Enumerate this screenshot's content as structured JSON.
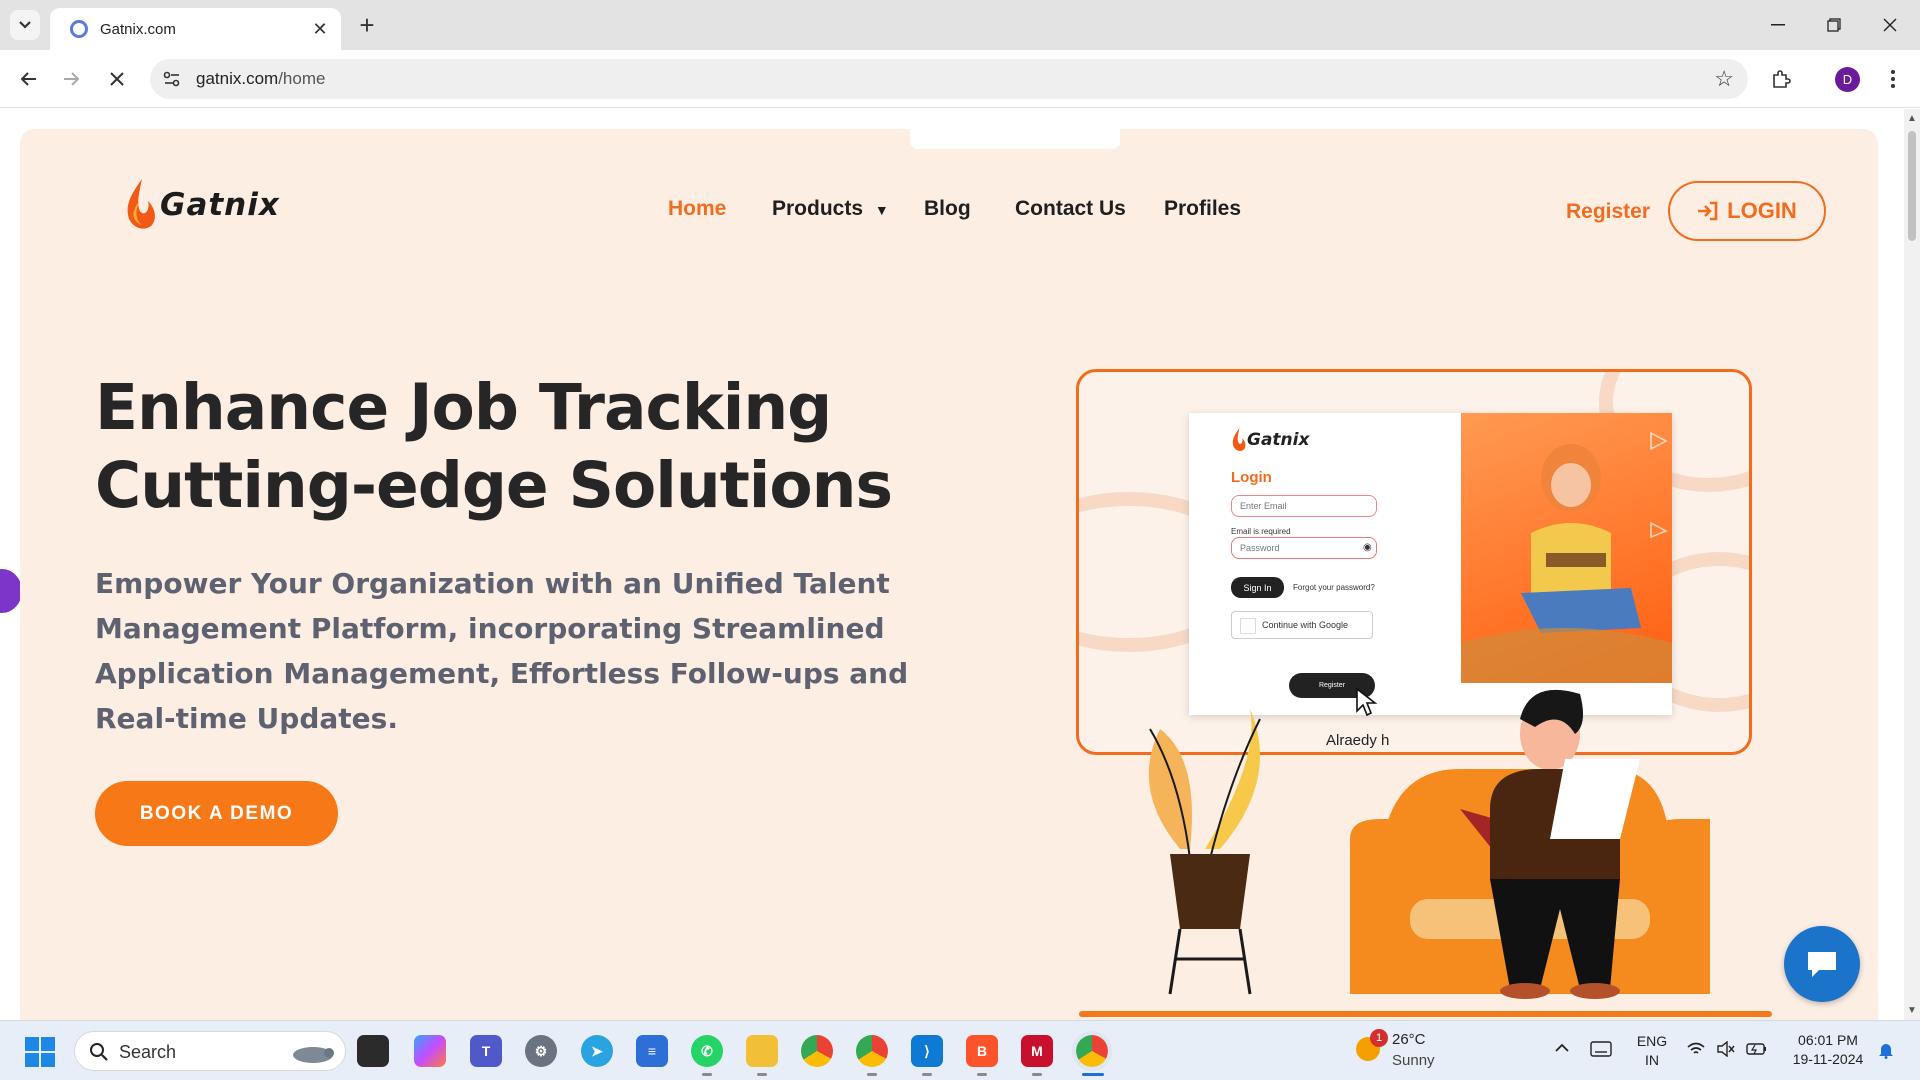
{
  "browser": {
    "tab_title": "Gatnix.com",
    "url_host": "gatnix.com",
    "url_path": "/home",
    "profile_initial": "D"
  },
  "site": {
    "brand": "Gatnix",
    "nav": [
      "Home",
      "Products",
      "Blog",
      "Contact Us",
      "Profiles"
    ],
    "active_nav": "Home",
    "register_label": "Register",
    "login_label": "LOGIN",
    "headline_line1": "Enhance Job Tracking",
    "headline_line2": "Cutting-edge Solutions",
    "subtext": "Empower Your Organization with an Unified Talent Management Platform, incorporating Streamlined Application Management, Effortless Follow-ups and Real-time Updates.",
    "demo_button": "BOOK A DEMO",
    "accent_color": "#f06d1f"
  },
  "illustration": {
    "brand": "Gatnix",
    "login_title": "Login",
    "email_placeholder": "Enter  Email",
    "email_error": "Email is required",
    "password_placeholder": "Password",
    "signin_label": "Sign In",
    "forgot_label": "Forgot your password?",
    "google_label": "Continue with Google",
    "register_label": "Register",
    "already_text": "Alraedy h"
  },
  "taskbar": {
    "search_placeholder": "Search",
    "weather_temp": "26°C",
    "weather_desc": "Sunny",
    "weather_badge": "1",
    "lang_line1": "ENG",
    "lang_line2": "IN",
    "time": "06:01 PM",
    "date": "19-11-2024"
  }
}
